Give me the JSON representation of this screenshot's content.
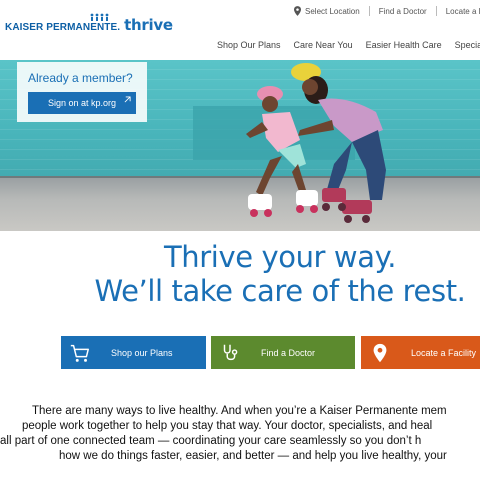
{
  "header": {
    "logo_brand": "KAISER PERMANENTE.",
    "logo_thrive": "thrive",
    "utility_nav": [
      {
        "label": "Select Location",
        "icon": "location-pin-icon"
      },
      {
        "label": "Find a Doctor"
      },
      {
        "label": "Locate a Facility"
      }
    ],
    "main_nav": [
      "Shop Our Plans",
      "Care Near You",
      "Easier Health Care",
      "Specialty C"
    ]
  },
  "hero": {
    "member_title": "Already a member?",
    "signon_label": "Sign on at kp.org",
    "signon_icon": "external-link-icon"
  },
  "headline": {
    "line1": "Thrive your way.",
    "line2": "We’ll take care of the rest."
  },
  "cta": {
    "plans": {
      "label": "Shop our Plans",
      "icon": "shopping-cart-icon",
      "color": "#1a6fb5"
    },
    "doctor": {
      "label": "Find a Doctor",
      "icon": "stethoscope-icon",
      "color": "#5c8a2e"
    },
    "facility": {
      "label": "Locate a Facility",
      "icon": "location-pin-icon",
      "color": "#d9591a"
    }
  },
  "intro": {
    "lines": [
      "There are many ways to live healthy. And when you’re a Kaiser Permanente mem",
      "people work together to help you stay that way. Your doctor, specialists, and heal",
      "all part of one connected team — coordinating your care seamlessly so you don’t h",
      "how we do things faster, easier, and better — and help you live healthy, your"
    ]
  },
  "colors": {
    "brand_blue": "#1a6fb5",
    "green": "#5c8a2e",
    "orange": "#d9591a"
  }
}
